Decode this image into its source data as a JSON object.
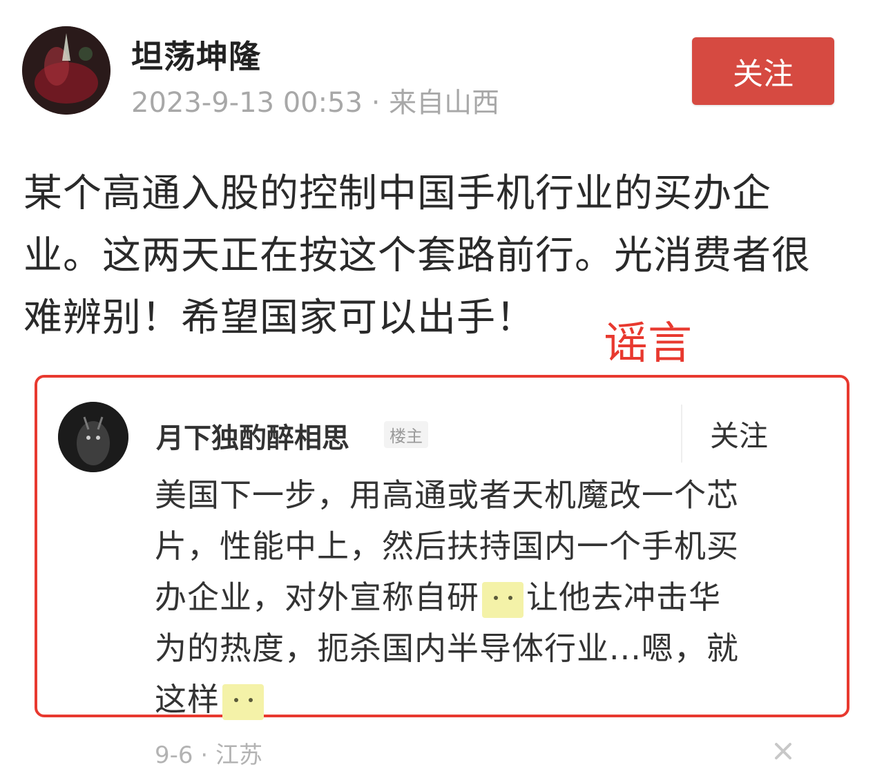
{
  "post": {
    "author_name": "坦荡坤隆",
    "meta": "2023-9-13 00:53 · 来自山西",
    "follow_label": "关注",
    "body_lines": [
      "某个高通入股的控制中国手机行业的买办企",
      "业。这两天正在按这个套路前行。光消费者很",
      "难辨别！希望国家可以出手！"
    ]
  },
  "annotation": {
    "label": "谣言",
    "color": "#e8392f"
  },
  "comment": {
    "author_name": "月下独酌醉相思",
    "badge": "楼主",
    "follow_label": "关注",
    "body": {
      "line1": "美国下一步，用高通或者天机魔改一个芯",
      "line2": "片，性能中上，然后扶持国内一个手机买",
      "line3_before_emoji": "办企业，对外宣称自研",
      "line3_after_emoji": "让他去冲击华",
      "line4": "为的热度，扼杀国内半导体行业...嗯，就",
      "line5_before_emoji": "这样"
    },
    "emoji_icon": "smirk-emoji-icon",
    "meta": "9-6 · 江苏",
    "dismiss_icon": "close-icon"
  },
  "colors": {
    "follow_button": "#d64a41",
    "highlight_border": "#e8392f"
  }
}
